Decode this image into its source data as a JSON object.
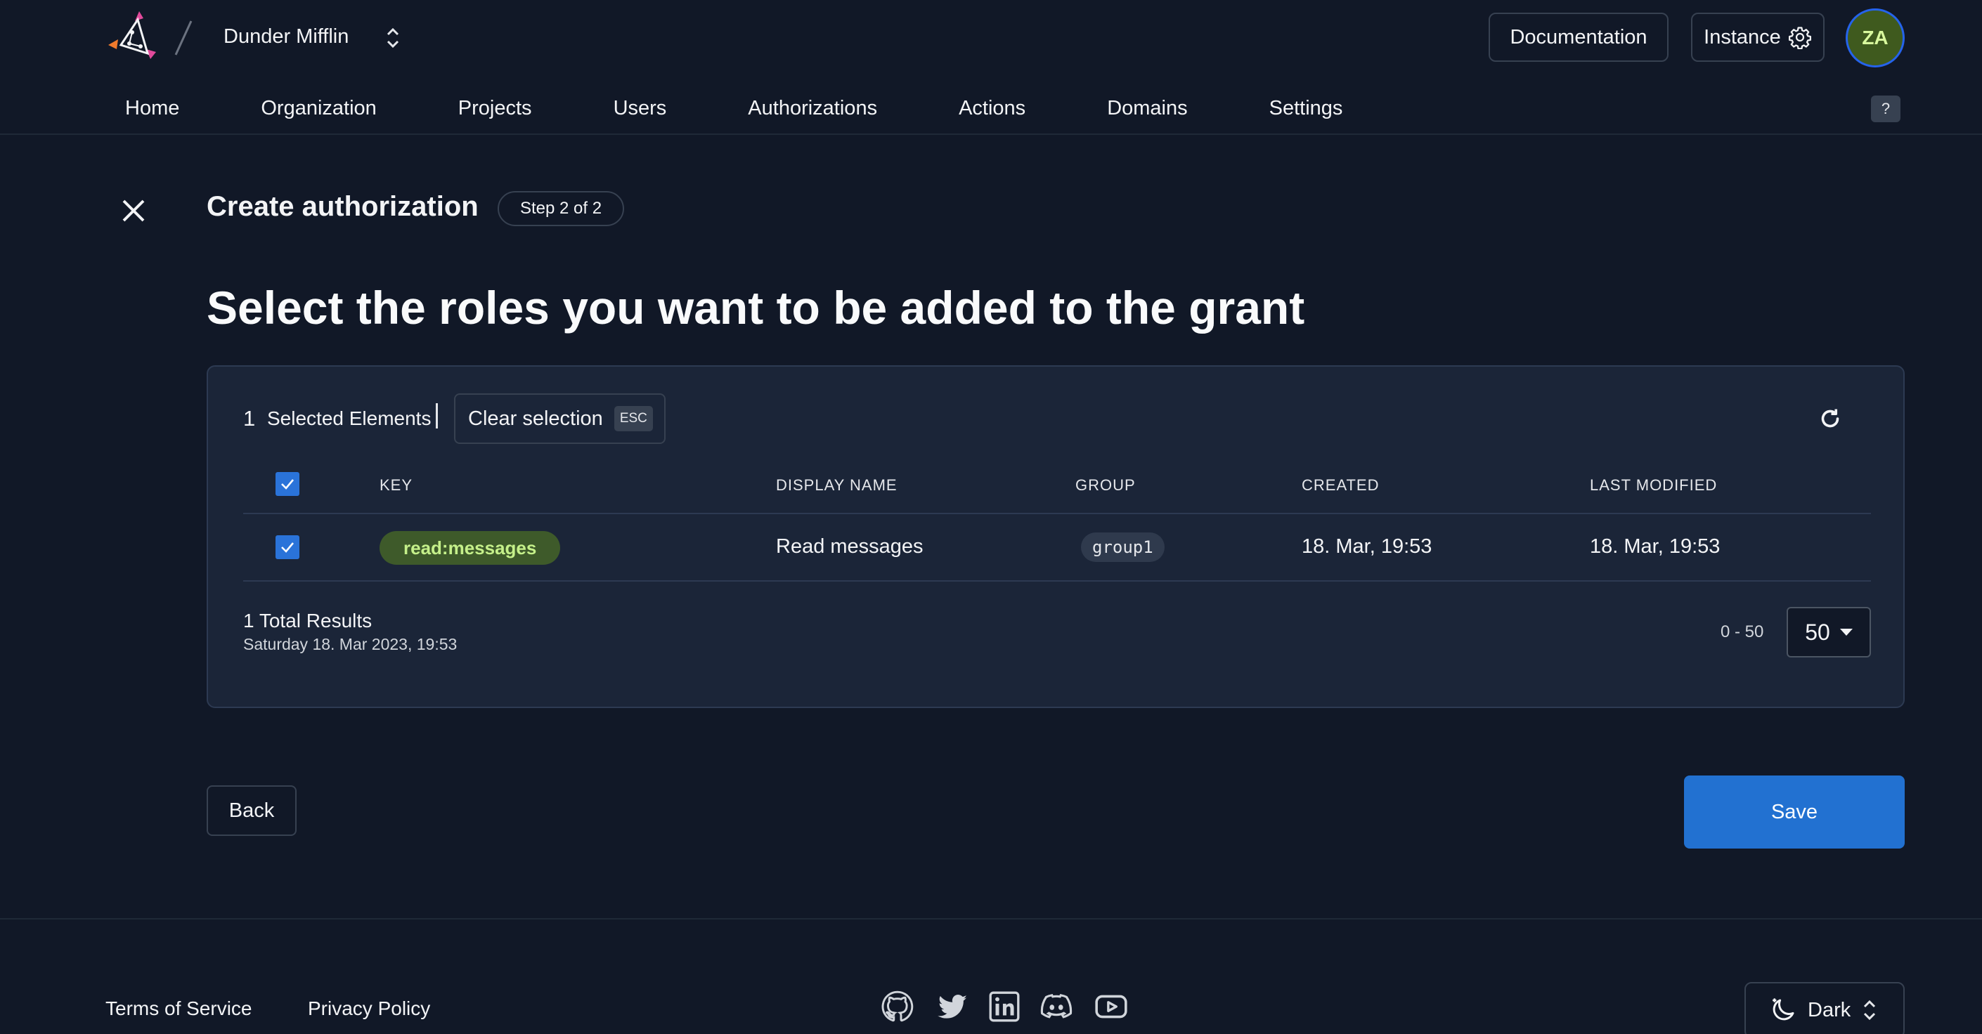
{
  "header": {
    "org_name": "Dunder Mifflin",
    "documentation_label": "Documentation",
    "instance_label": "Instance",
    "avatar_initials": "ZA",
    "help_label": "?"
  },
  "nav": {
    "items": [
      "Home",
      "Organization",
      "Projects",
      "Users",
      "Authorizations",
      "Actions",
      "Domains",
      "Settings"
    ]
  },
  "page": {
    "title": "Create authorization",
    "step": "Step 2 of 2",
    "headline": "Select the roles you want to be added to the grant"
  },
  "selection": {
    "count": "1",
    "label": "Selected Elements",
    "clear_label": "Clear selection",
    "esc_label": "ESC"
  },
  "table": {
    "columns": [
      "KEY",
      "DISPLAY NAME",
      "GROUP",
      "CREATED",
      "LAST MODIFIED"
    ],
    "rows": [
      {
        "key": "read:messages",
        "display_name": "Read messages",
        "group": "group1",
        "created": "18. Mar, 19:53",
        "last_modified": "18. Mar, 19:53",
        "selected": true
      }
    ]
  },
  "pagination": {
    "total": "1 Total Results",
    "timestamp": "Saturday 18. Mar 2023, 19:53",
    "range": "0 - 50",
    "page_size": "50"
  },
  "actions": {
    "back_label": "Back",
    "save_label": "Save"
  },
  "footer": {
    "terms": "Terms of Service",
    "privacy": "Privacy Policy",
    "social_icons": [
      "github-icon",
      "twitter-icon",
      "linkedin-icon",
      "discord-icon",
      "youtube-icon"
    ],
    "theme_label": "Dark"
  },
  "colors": {
    "background": "#111827",
    "card": "#1b2538",
    "accent": "#2271d1",
    "key_chip": "#3e5a2a",
    "avatar": "#3f5a1e"
  }
}
